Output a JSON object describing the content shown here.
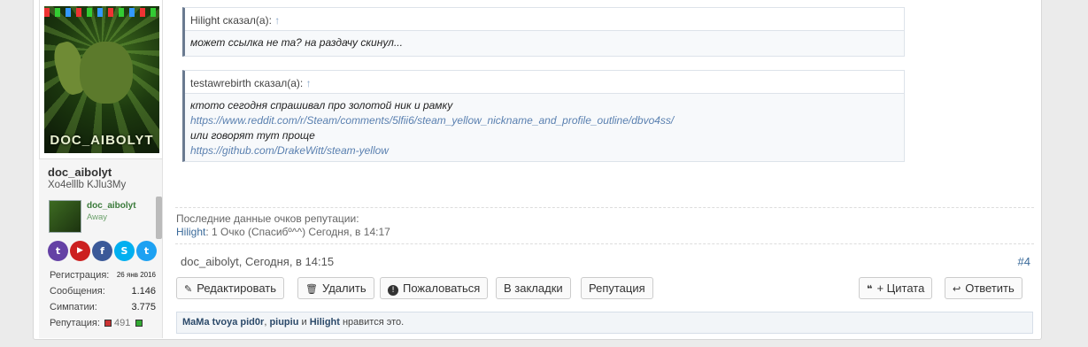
{
  "user": {
    "avatar_text": "DOC_AIBOLYT",
    "name": "doc_aibolyt",
    "title": "Xo4elllb KJlu3My",
    "mini_name": "doc_aibolyt",
    "mini_status": "Away",
    "socials": [
      {
        "icon": "twitch-icon",
        "glyph": "t",
        "color": "#6441a5"
      },
      {
        "icon": "youtube-icon",
        "glyph": "▶",
        "color": "#cc2020"
      },
      {
        "icon": "facebook-icon",
        "glyph": "f",
        "color": "#3b5998"
      },
      {
        "icon": "skype-icon",
        "glyph": "S",
        "color": "#00aff0"
      },
      {
        "icon": "twitter-icon",
        "glyph": "t",
        "color": "#1da1f2"
      }
    ],
    "stats": {
      "reg_label": "Регистрация:",
      "reg_value": "26 янв 2016",
      "msg_label": "Сообщения:",
      "msg_value": "1.146",
      "likes_label": "Симпатии:",
      "likes_value": "3.775",
      "rep_label": "Репутация:",
      "rep_value": "491"
    }
  },
  "quotes": [
    {
      "author": "Hilight сказал(а):",
      "arrow": "↑",
      "lines": [
        "может ссылка не та? на раздачу скинул..."
      ]
    },
    {
      "author": "testawrebirth сказал(а):",
      "arrow": "↑",
      "line1": "ктото сегодня спрашивал про золотой ник и рамку",
      "link1": "https://www.reddit.com/r/Steam/comments/5lfii6/steam_yellow_nickname_and_profile_outline/dbvo4ss/",
      "line2": "или говорят тут проще",
      "link2": "https://github.com/DrakeWitt/steam-yellow"
    }
  ],
  "reputation": {
    "heading": "Последние данные очков репутации:",
    "name": "Hilight",
    "rest": ": 1 Очко (Спасибº^^) Сегодня, в 14:17"
  },
  "post": {
    "meta": "doc_aibolyt, Сегодня, в 14:15",
    "number": "#4"
  },
  "actions": {
    "edit": "Редактировать",
    "delete": "Удалить",
    "report": "Пожаловаться",
    "bookmark": "В закладки",
    "reputation": "Репутация",
    "quote": "+ Цитата",
    "reply": "Ответить"
  },
  "likes": {
    "user1": "MaMa tvoya pid0r",
    "sep1": ", ",
    "user2": "piupiu",
    "sep2": " и ",
    "user3": "Hilight",
    "suffix": " нравится это."
  }
}
